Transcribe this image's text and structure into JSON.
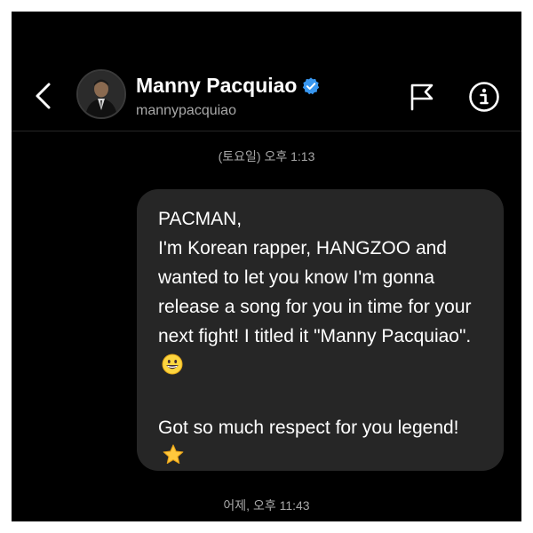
{
  "header": {
    "contact_name": "Manny Pacquiao",
    "handle": "mannypacquiao",
    "verified": true,
    "icons": {
      "back": "chevron-left-icon",
      "report": "flag-icon",
      "info": "info-icon",
      "verified": "verified-badge-icon"
    }
  },
  "conversation": {
    "timestamp_top": "(토요일) 오후 1:13",
    "message": {
      "greeting": "PACMAN,",
      "body": "I'm Korean rapper, HANGZOO and wanted to let you know I'm gonna release a song for you in time for your next fight! I titled it \"Manny Pacquiao\".",
      "body_emoji": "grinning-face-emoji",
      "closing": "Got so much respect for you legend!",
      "closing_emoji": "star-emoji"
    },
    "timestamp_bottom": "어제, 오후 11:43"
  },
  "colors": {
    "background": "#000000",
    "bubble": "#262626",
    "text_primary": "#ffffff",
    "text_secondary": "#a8a8a8",
    "verified_blue": "#3897f0"
  }
}
